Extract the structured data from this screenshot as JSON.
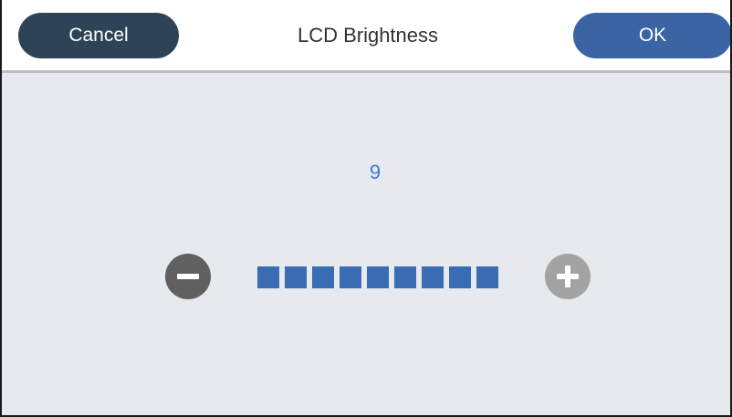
{
  "header": {
    "title": "LCD Brightness",
    "cancel_label": "Cancel",
    "ok_label": "OK"
  },
  "brightness": {
    "value_text": "9",
    "level": 9,
    "max_level": 9,
    "filled_color": "#3a6bb3",
    "empty_color": "#c9cdd2"
  },
  "icons": {
    "decrease": "minus-icon",
    "increase": "plus-icon"
  },
  "colors": {
    "cancel_button": "#2f4357",
    "ok_button": "#3a64a3",
    "value_text": "#3d78d4",
    "background": "#e6e9ed"
  }
}
